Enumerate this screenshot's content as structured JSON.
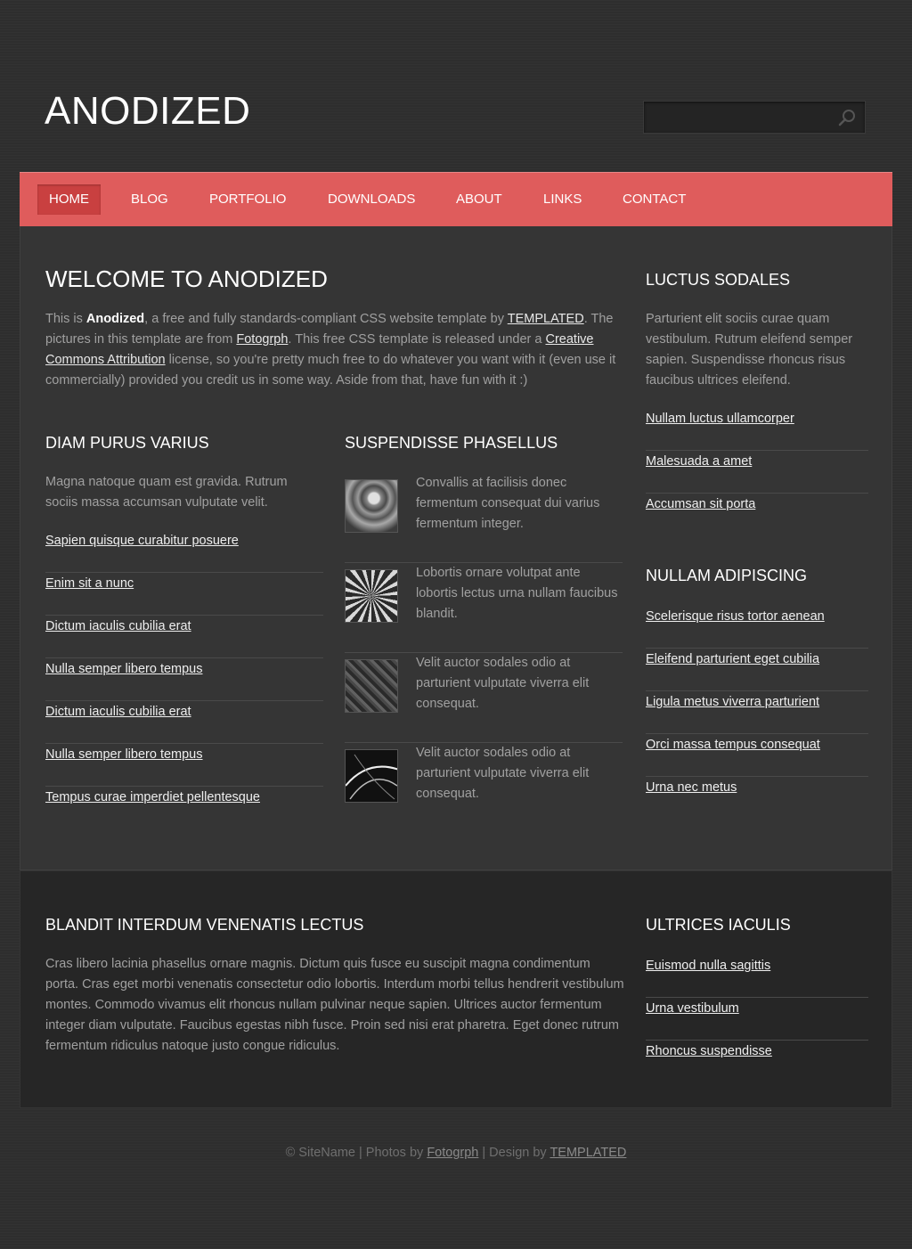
{
  "header": {
    "logo": "ANODIZED",
    "search": {
      "placeholder": "",
      "value": ""
    }
  },
  "nav": {
    "items": [
      {
        "label": "HOME",
        "active": true
      },
      {
        "label": "BLOG"
      },
      {
        "label": "PORTFOLIO"
      },
      {
        "label": "DOWNLOADS"
      },
      {
        "label": "ABOUT"
      },
      {
        "label": "LINKS"
      },
      {
        "label": "CONTACT"
      }
    ]
  },
  "welcome": {
    "title": "WELCOME TO ANODIZED",
    "intro_1": "This is ",
    "intro_brand": "Anodized",
    "intro_2": ", a free and fully standards-compliant CSS website template by ",
    "intro_link_templated": "TEMPLATED",
    "intro_3": ". The pictures in this template are from ",
    "intro_link_fotogrph": "Fotogrph",
    "intro_4": ". This free CSS template is released under a ",
    "intro_link_cc": "Creative Commons Attribution",
    "intro_5": " license, so you're pretty much free to do whatever you want with it (even use it commercially) provided you credit us in some way. Aside from that, have fun with it :)"
  },
  "diam": {
    "title": "DIAM PURUS VARIUS",
    "text": "Magna natoque quam est gravida. Rutrum sociis massa accumsan vulputate velit.",
    "links": [
      "Sapien quisque curabitur posuere",
      "Enim sit a nunc",
      "Dictum iaculis cubilia erat",
      "Nulla semper libero tempus",
      "Dictum iaculis cubilia erat",
      "Nulla semper libero tempus",
      "Tempus curae imperdiet pellentesque"
    ]
  },
  "suspendisse": {
    "title": "SUSPENDISSE PHASELLUS",
    "items": [
      {
        "text": "Convallis at facilisis donec fermentum consequat dui varius fermentum integer."
      },
      {
        "text": "Lobortis ornare volutpat ante lobortis lectus urna nullam faucibus blandit."
      },
      {
        "text": "Velit auctor sodales odio at parturient vulputate viverra elit consequat."
      },
      {
        "text": "Velit auctor sodales odio at parturient vulputate viverra elit consequat."
      }
    ]
  },
  "luctus": {
    "title": "LUCTUS SODALES",
    "text": "Parturient elit sociis curae quam vestibulum. Rutrum eleifend semper sapien. Suspendisse rhoncus risus faucibus ultrices eleifend.",
    "links": [
      "Nullam luctus ullamcorper",
      "Malesuada a amet",
      "Accumsan sit porta"
    ]
  },
  "nullam": {
    "title": "NULLAM ADIPISCING",
    "links": [
      "Scelerisque risus tortor aenean",
      "Eleifend parturient eget cubilia",
      "Ligula metus viverra parturient",
      "Orci massa tempus consequat",
      "Urna nec metus"
    ]
  },
  "blandit": {
    "title": "BLANDIT INTERDUM VENENATIS LECTUS",
    "text": "Cras libero lacinia phasellus ornare magnis. Dictum quis fusce eu suscipit magna condimentum porta. Cras eget morbi venenatis consectetur odio lobortis. Interdum morbi tellus hendrerit vestibulum montes. Commodo vivamus elit rhoncus nullam pulvinar neque sapien. Ultrices auctor fermentum integer diam vulputate. Faucibus egestas nibh fusce. Proin sed nisi erat pharetra. Eget donec rutrum fermentum ridiculus natoque justo congue ridiculus."
  },
  "ultrices": {
    "title": "ULTRICES IACULIS",
    "links": [
      "Euismod nulla sagittis",
      "Urna vestibulum",
      "Rhoncus suspendisse"
    ]
  },
  "footer": {
    "prefix": "© SiteName | Photos by ",
    "photos_link": "Fotogrph",
    "middle": " | Design by ",
    "design_link": "TEMPLATED"
  },
  "colors": {
    "background": "#2e2e2e",
    "nav": "#df5c5c",
    "nav_active": "#c94040",
    "panel": "#353535",
    "lower_panel": "#262626"
  }
}
